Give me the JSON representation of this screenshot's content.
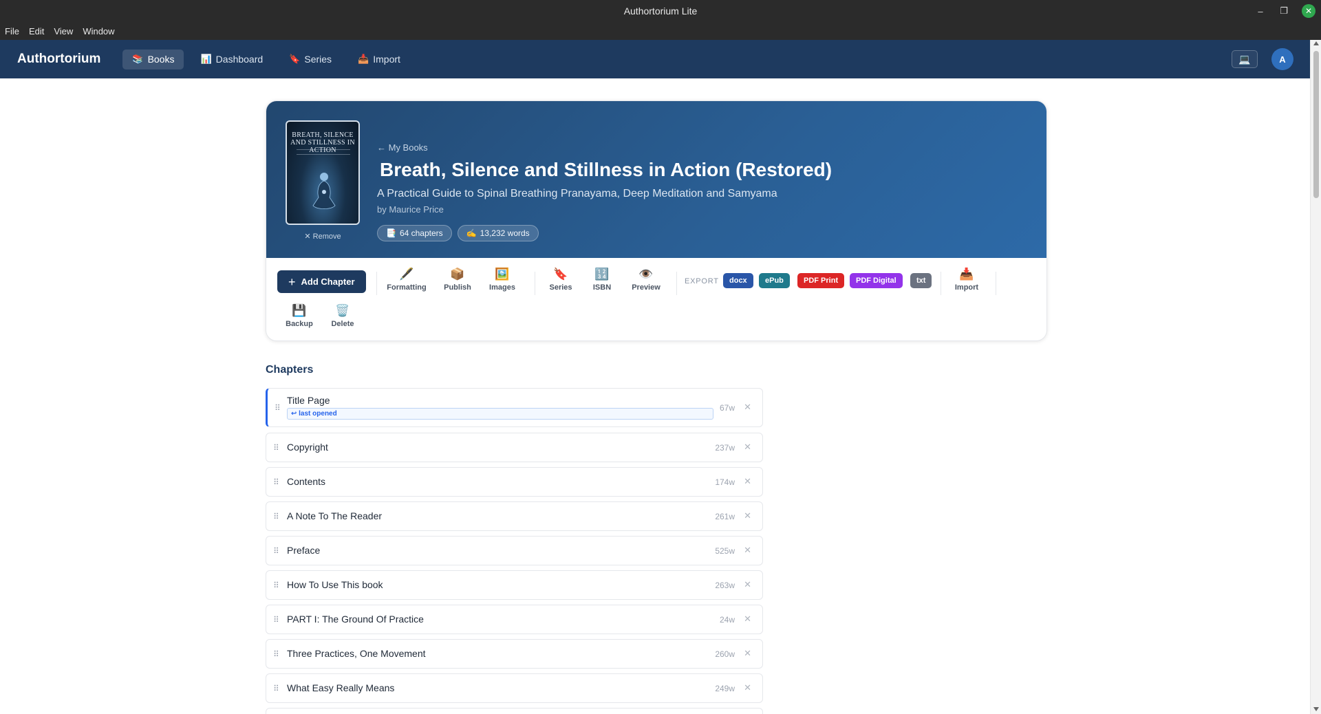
{
  "window": {
    "title": "Authortorium Lite"
  },
  "menu": [
    "File",
    "Edit",
    "View",
    "Window"
  ],
  "appbar": {
    "brand": "Authortorium",
    "nav": [
      {
        "icon": "📚",
        "label": "Books"
      },
      {
        "icon": "📊",
        "label": "Dashboard"
      },
      {
        "icon": "🔖",
        "label": "Series"
      },
      {
        "icon": "📥",
        "label": "Import"
      }
    ],
    "device_icon": "💻",
    "avatar_initial": "A"
  },
  "book": {
    "cover_title": "BREATH, SILENCE AND STILLNESS IN ACTION",
    "remove_label": "✕ Remove",
    "back_label": "← My Books",
    "title": "Breath, Silence and Stillness in Action (Restored)",
    "subtitle": "A Practical Guide to Spinal Breathing Pranayama, Deep Meditation and Samyama",
    "author": "by Maurice Price",
    "chapters_pill": {
      "icon": "📑",
      "label": "64 chapters"
    },
    "words_pill": {
      "icon": "✍️",
      "label": "13,232 words"
    }
  },
  "toolbar": {
    "add_chapter_label": "Add Chapter",
    "tools": [
      {
        "icon": "🖋️",
        "label": "Formatting"
      },
      {
        "icon": "📦",
        "label": "Publish"
      },
      {
        "icon": "🖼️",
        "label": "Images"
      },
      {
        "icon": "🔖",
        "label": "Series"
      },
      {
        "icon": "🔢",
        "label": "ISBN"
      },
      {
        "icon": "👁️",
        "label": "Preview"
      }
    ],
    "export_label": "EXPORT",
    "exports": [
      {
        "label": "docx",
        "color": "#2a56a8"
      },
      {
        "label": "ePub",
        "color": "#1f7a8c"
      },
      {
        "label": "PDF Print",
        "color": "#dc2626"
      },
      {
        "label": "PDF Digital",
        "color": "#9333ea"
      },
      {
        "label": "txt",
        "color": "#6b7280"
      }
    ],
    "import": {
      "icon": "📥",
      "label": "Import"
    },
    "backup": {
      "icon": "💾",
      "label": "Backup"
    },
    "delete": {
      "icon": "🗑️",
      "label": "Delete"
    }
  },
  "chapters": {
    "heading": "Chapters",
    "last_opened_label": "↩ last opened",
    "items": [
      {
        "title": "Title Page",
        "words": "67w"
      },
      {
        "title": "Copyright",
        "words": "237w"
      },
      {
        "title": "Contents",
        "words": "174w"
      },
      {
        "title": "A Note To The Reader",
        "words": "261w"
      },
      {
        "title": "Preface",
        "words": "525w"
      },
      {
        "title": "How To Use This book",
        "words": "263w"
      },
      {
        "title": "PART I: The Ground Of Practice",
        "words": "24w"
      },
      {
        "title": "Three Practices, One Movement",
        "words": "260w"
      },
      {
        "title": "What Easy Really Means",
        "words": "249w"
      }
    ]
  }
}
